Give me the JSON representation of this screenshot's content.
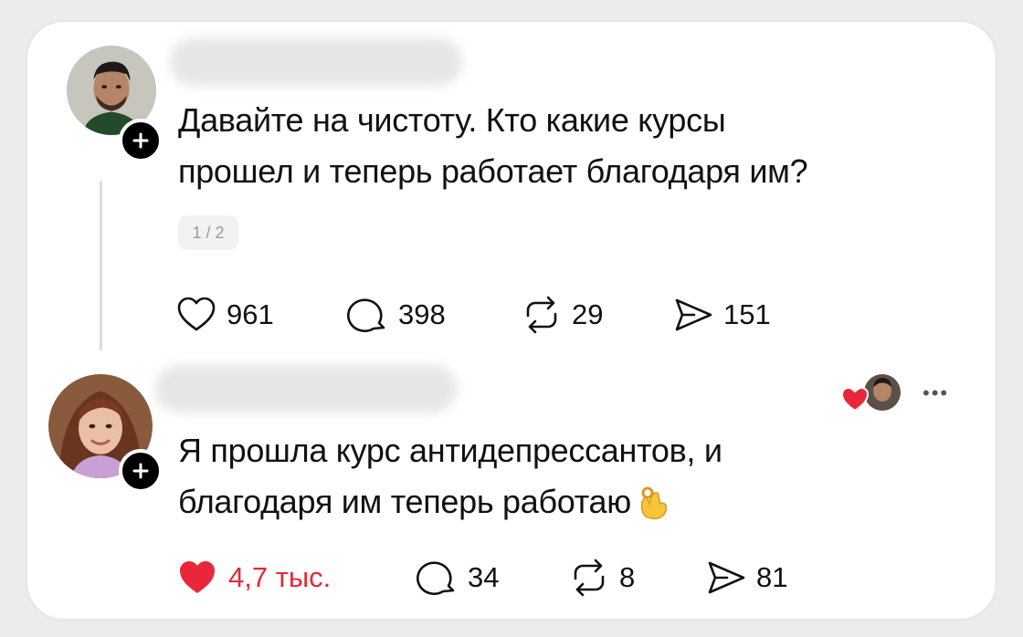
{
  "colors": {
    "like_red": "#e8283a",
    "text": "#111111",
    "muted": "#999999"
  },
  "post": {
    "text_line1": "Давайте на чистоту. Кто какие курсы",
    "text_line2": "прошел и теперь работает благодаря им?",
    "pager": "1 / 2",
    "likes": "961",
    "replies": "398",
    "reposts": "29",
    "shares": "151",
    "icons": [
      "heart-outline-icon",
      "comment-icon",
      "repost-icon",
      "share-icon",
      "follow-plus-icon"
    ]
  },
  "reply": {
    "text_line1": "Я прошла курс антидепрессантов, и",
    "text_line2": "благодаря им теперь работаю",
    "emoji": "ok-hand-emoji",
    "likes": "4,7 тыс.",
    "liked": 1,
    "replies": "34",
    "reposts": "8",
    "shares": "81",
    "icons": [
      "heart-filled-icon",
      "comment-icon",
      "repost-icon",
      "share-icon",
      "more-icon",
      "follow-plus-icon"
    ]
  }
}
